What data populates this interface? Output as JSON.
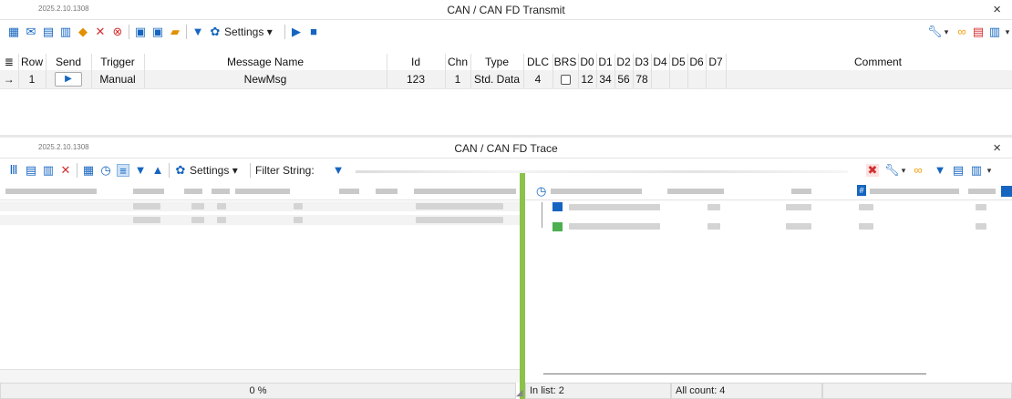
{
  "transmit": {
    "version": "2025.2.10.1308",
    "title": "CAN / CAN FD Transmit",
    "close": "×",
    "settings_label": "Settings",
    "columns": [
      "Row",
      "Send",
      "Trigger",
      "Message Name",
      "Id",
      "Chn",
      "Type",
      "DLC",
      "BRS",
      "D0",
      "D1",
      "D2",
      "D3",
      "D4",
      "D5",
      "D6",
      "D7",
      "Comment"
    ],
    "row": {
      "marker": "→",
      "row": "1",
      "trigger": "Manual",
      "name": "NewMsg",
      "id": "123",
      "chn": "1",
      "type": "Std. Data",
      "dlc": "4",
      "d0": "12",
      "d1": "34",
      "d2": "56",
      "d3": "78"
    }
  },
  "trace": {
    "version": "2025.2.10.1308",
    "title": "CAN / CAN FD Trace",
    "close": "×",
    "settings_label": "Settings",
    "filter_label": "Filter String:"
  },
  "status": {
    "progress": "0 %",
    "progress_value": 0,
    "in_list": "In list: 2",
    "all_count": "All count: 4"
  },
  "colors": {
    "accent_blue": "#1565c0",
    "green_divider": "#8bc34a",
    "red_icon": "#d32f2f",
    "orange_icon": "#f59e0b"
  }
}
